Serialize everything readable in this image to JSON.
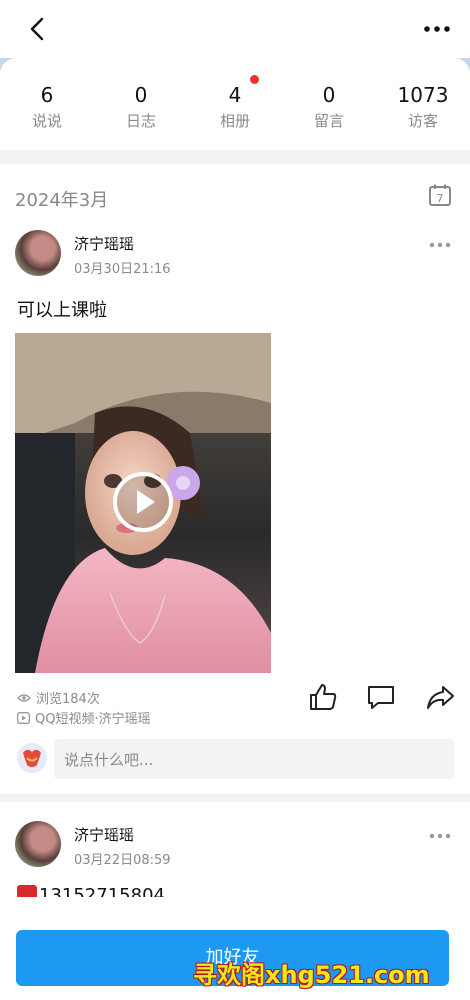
{
  "header": {
    "back_icon": "chevron-left-icon",
    "more_icon": "more-dots-icon"
  },
  "stats": [
    {
      "count": "6",
      "label": "说说"
    },
    {
      "count": "0",
      "label": "日志"
    },
    {
      "count": "4",
      "label": "相册",
      "has_dot": true
    },
    {
      "count": "0",
      "label": "留言"
    },
    {
      "count": "1073",
      "label": "访客"
    }
  ],
  "month": {
    "label": "2024年3月",
    "calendar_day": "7"
  },
  "posts": [
    {
      "author": "济宁瑶瑶",
      "time": "03月30日21:16",
      "text": "可以上课啦",
      "views": "浏览184次",
      "source": "QQ短视频·济宁瑶瑶"
    },
    {
      "author": "济宁瑶瑶",
      "time": "03月22日08:59",
      "text": "13152715804"
    }
  ],
  "comment": {
    "placeholder": "说点什么吧..."
  },
  "bottom_button": {
    "label": "加好友"
  },
  "watermark": "寻欢阁xhg521.com",
  "colors": {
    "primary": "#1d99f3",
    "badge_red": "#f0322e",
    "muted_text": "#8a8a8a"
  }
}
